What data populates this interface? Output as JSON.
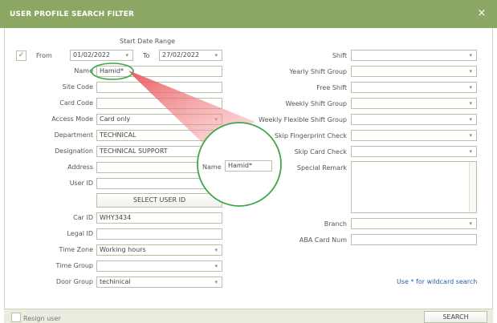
{
  "dialog": {
    "title": "USER PROFILE SEARCH FILTER",
    "close_glyph": "×"
  },
  "date_range": {
    "caption": "Start Date Range",
    "checkbox_checked": true,
    "check_glyph": "✓",
    "from_label": "From",
    "from_value": "01/02/2022",
    "to_label": "To",
    "to_value": "27/02/2022"
  },
  "left_fields": {
    "name": {
      "label": "Name",
      "value": "Hamid*"
    },
    "site_code": {
      "label": "Site Code",
      "value": ""
    },
    "card_code": {
      "label": "Card Code",
      "value": ""
    },
    "access_mode": {
      "label": "Access Mode",
      "value": "Card only"
    },
    "department": {
      "label": "Department",
      "value": "TECHNICAL"
    },
    "designation": {
      "label": "Designation",
      "value": "TECHNICAL SUPPORT"
    },
    "address": {
      "label": "Address",
      "value": ""
    },
    "user_id": {
      "label": "User ID",
      "value": ""
    },
    "select_user_id_button": "SELECT USER ID",
    "car_id": {
      "label": "Car ID",
      "value": "WHY3434"
    },
    "legal_id": {
      "label": "Legal ID",
      "value": ""
    },
    "time_zone": {
      "label": "Time Zone",
      "value": "Working hours"
    },
    "time_group": {
      "label": "Time Group",
      "value": ""
    },
    "door_group": {
      "label": "Door Group",
      "value": "techinical"
    }
  },
  "right_fields": {
    "shift": {
      "label": "Shift",
      "value": ""
    },
    "yearly_shift_group": {
      "label": "Yearly Shift Group",
      "value": ""
    },
    "free_shift": {
      "label": "Free Shift",
      "value": ""
    },
    "weekly_shift_group": {
      "label": "Weekly Shift Group",
      "value": ""
    },
    "weekly_flexible_shift_group": {
      "label": "Weekly Flexible Shift Group",
      "value": ""
    },
    "skip_fingerprint_check": {
      "label": "Skip Fingerprint Check",
      "value": ""
    },
    "skip_card_check": {
      "label": "Skip Card Check",
      "value": ""
    },
    "special_remark": {
      "label": "Special Remark",
      "value": ""
    },
    "branch": {
      "label": "Branch",
      "value": ""
    },
    "aba_card_num": {
      "label": "ABA Card Num",
      "value": ""
    }
  },
  "zoom_callout": {
    "label": "Name",
    "value": "Hamid*"
  },
  "hint": "Use * for wildcard search",
  "footer": {
    "resign_label": "Resign user",
    "search_button": "SEARCH"
  },
  "colors": {
    "header": "#8ca764",
    "callout_ring": "#3fa64a",
    "callout_beam": "#e8545a",
    "hint": "#2d5ba8"
  }
}
